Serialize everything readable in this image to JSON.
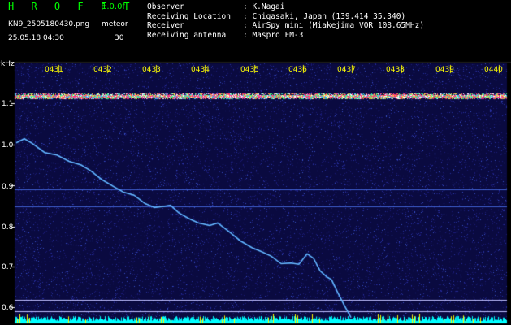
{
  "header": {
    "app_title": "H R O F F T",
    "version": "1.0.0f",
    "filename": "KN9_2505180430.png",
    "mode": "meteor",
    "datetime": "25.05.18 04:30",
    "count": "30"
  },
  "station": {
    "observer_label": "Observer",
    "observer_value": ": K.Nagai",
    "location_label": "Receiving Location",
    "location_value": ": Chigasaki, Japan (139.414 35.340)",
    "receiver_label": "Receiver",
    "receiver_value": ": AirSpy mini (Miakejima VOR 108.65MHz)",
    "antenna_label": "Receiving antenna",
    "antenna_value": ": Maspro FM-3"
  },
  "spectrogram": {
    "unit_label": "kHz",
    "y_ticks": [
      "1.1",
      "1.0",
      "0.9",
      "0.8",
      "0.7",
      "0.6"
    ],
    "time_ticks": [
      "0431",
      "0432",
      "0433",
      "0434",
      "0435",
      "0436",
      "0437",
      "0438",
      "0439",
      "0440"
    ],
    "colors": {
      "background": "#000000",
      "noise": "#101060",
      "time_tick": "#ffff00",
      "trace": "#40a0ff",
      "baseline": "#00ffff",
      "carrier": "#ff4060"
    }
  }
}
